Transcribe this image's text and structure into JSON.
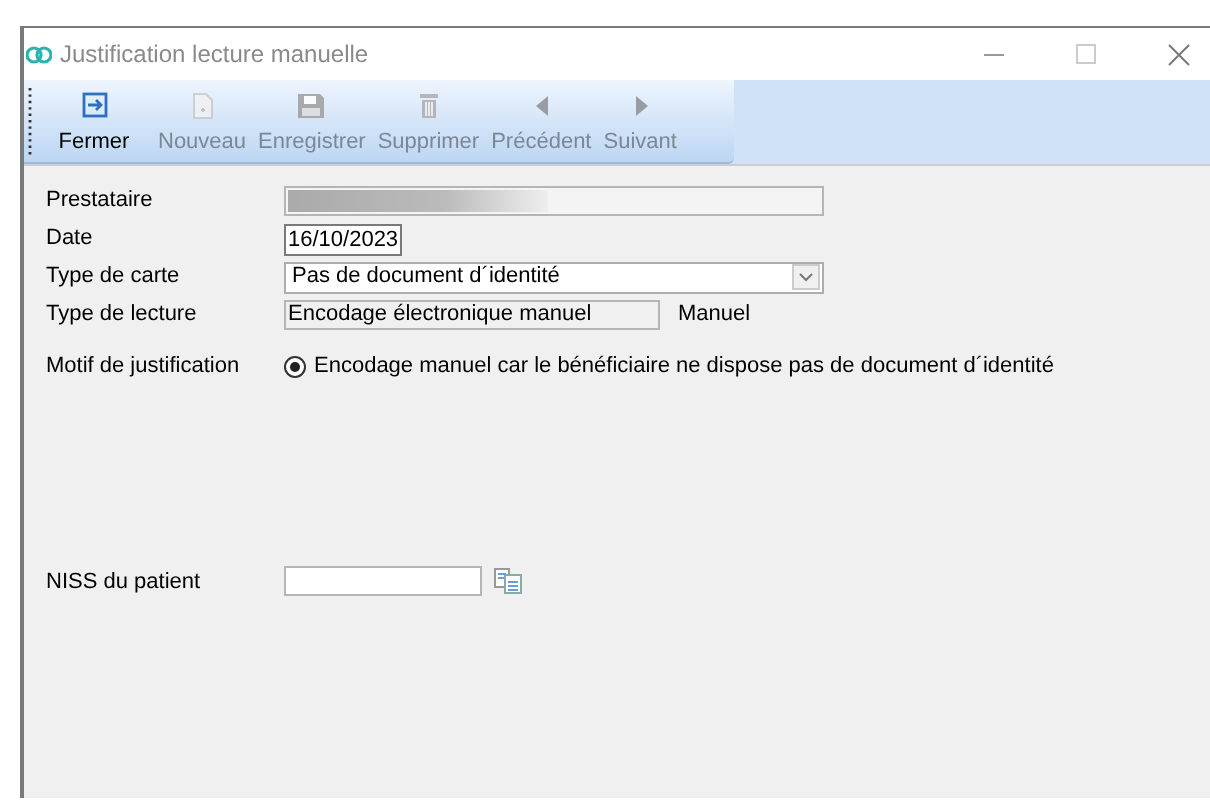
{
  "window": {
    "title": "Justification lecture manuelle"
  },
  "toolbar": [
    {
      "label": "Fermer",
      "kind": "close",
      "disabled": false
    },
    {
      "label": "Nouveau",
      "kind": "new",
      "disabled": true
    },
    {
      "label": "Enregistrer",
      "kind": "save",
      "disabled": true
    },
    {
      "label": "Supprimer",
      "kind": "delete",
      "disabled": true
    },
    {
      "label": "Précédent",
      "kind": "prev",
      "disabled": true
    },
    {
      "label": "Suivant",
      "kind": "next",
      "disabled": true
    }
  ],
  "form": {
    "prestataire": {
      "label": "Prestataire"
    },
    "date": {
      "label": "Date",
      "value": "16/10/2023"
    },
    "type_carte": {
      "label": "Type de carte",
      "value": "Pas de document d´identité"
    },
    "type_lecture": {
      "label": "Type de lecture",
      "value": "Encodage électronique manuel",
      "suffix": "Manuel"
    },
    "motif": {
      "label": "Motif de justification",
      "options": [
        {
          "label": "Encodage manuel car le bénéficiaire ne dispose pas de document d´identité",
          "selected": true
        }
      ]
    },
    "niss": {
      "label": "NISS du patient"
    }
  }
}
